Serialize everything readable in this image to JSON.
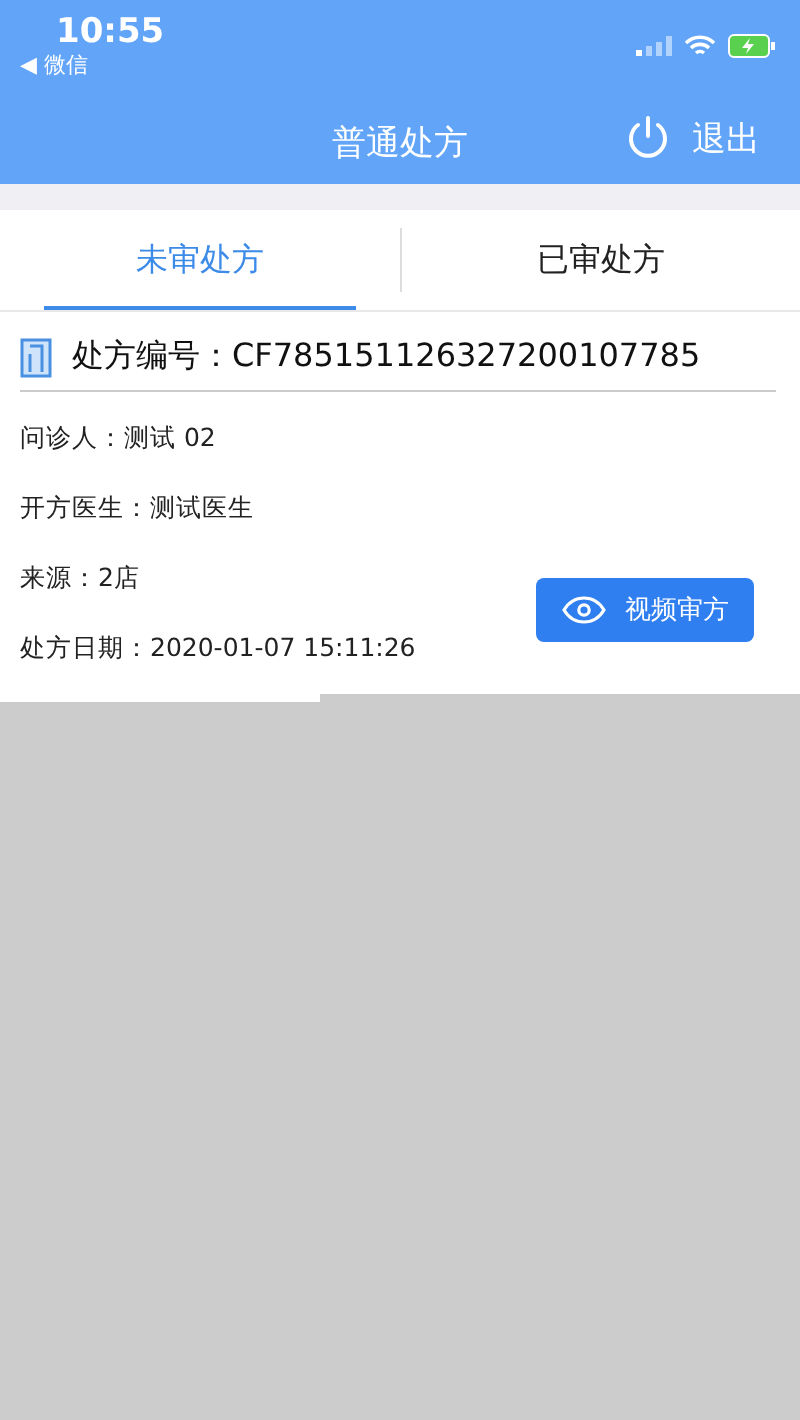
{
  "status_bar": {
    "time": "10:55",
    "back_app": "◀ 微信"
  },
  "header": {
    "title": "普通处方",
    "logout": "退出"
  },
  "tabs": [
    {
      "label": "未审处方",
      "selected": true
    },
    {
      "label": "已审处方",
      "selected": false
    }
  ],
  "prescription": {
    "number_label": "处方编号：",
    "number": "CF785151126327200107785",
    "fields": [
      {
        "label": "问诊人：",
        "value": "测试 02"
      },
      {
        "label": "开方医生：",
        "value": "测试医生"
      },
      {
        "label": "来源：",
        "value": "2店"
      },
      {
        "label": "处方日期：",
        "value": "2020-01-07 15:11:26"
      }
    ],
    "button": "视频审方"
  }
}
